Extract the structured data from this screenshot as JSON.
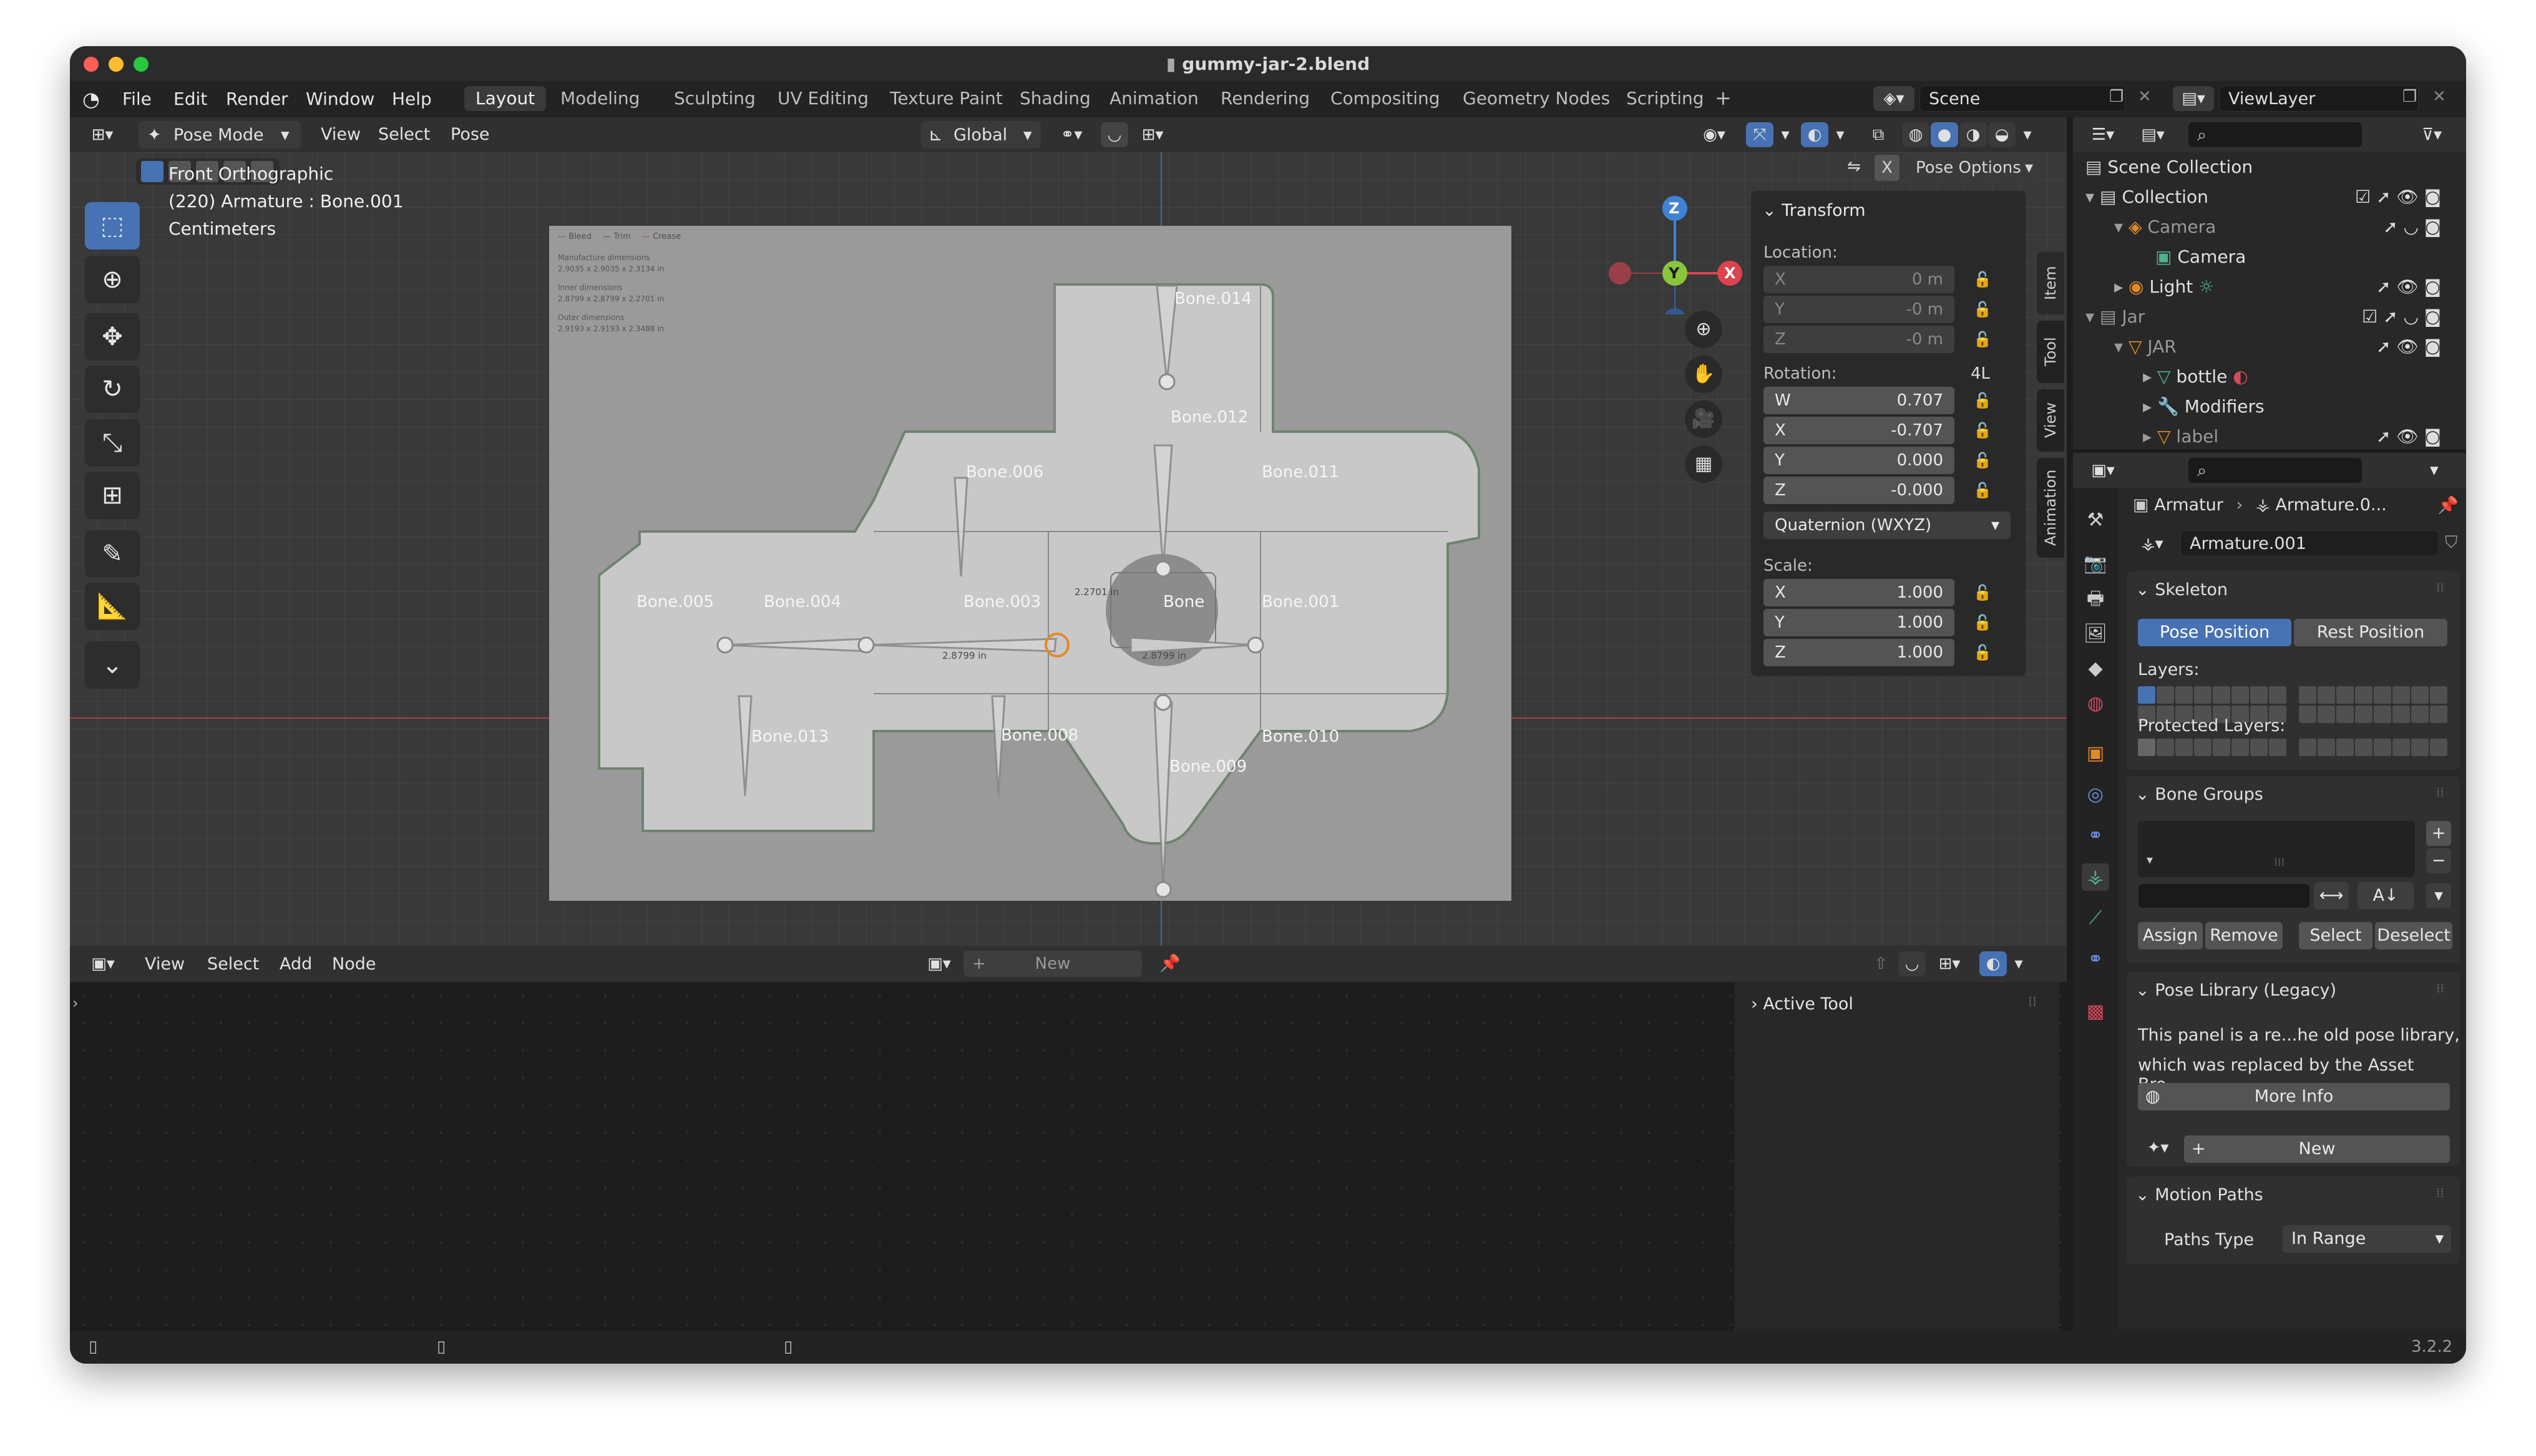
{
  "window": {
    "title": "gummy-jar-2.blend",
    "version": "3.2.2"
  },
  "menu": [
    "File",
    "Edit",
    "Render",
    "Window",
    "Help"
  ],
  "workspaces": [
    "Layout",
    "Modeling",
    "Sculpting",
    "UV Editing",
    "Texture Paint",
    "Shading",
    "Animation",
    "Rendering",
    "Compositing",
    "Geometry Nodes",
    "Scripting"
  ],
  "active_workspace": "Layout",
  "scene": {
    "name": "Scene",
    "view_layer": "ViewLayer"
  },
  "viewport": {
    "mode": "Pose Mode",
    "header_menus": [
      "View",
      "Select",
      "Pose"
    ],
    "orientation": "Global",
    "overlay_lines": [
      "Front Orthographic",
      "(220) Armature : Bone.001",
      "Centimeters"
    ],
    "pose_options": "Pose Options",
    "gizmo_axes": {
      "z": "Z",
      "y": "Y",
      "x": "X"
    },
    "dieline_legend": [
      "Bleed",
      "Trim",
      "Crease"
    ],
    "dieline_notes": [
      "Manufacture dimensions",
      "2.9035 x 2.9035 x 2.3134 in",
      "Inner dimensions",
      "2.8799 x 2.8799 x 2.2701 in",
      "Outer dimensions",
      "2.9193 x 2.9193 x 2.3488 in"
    ],
    "dim_labels": [
      "2.8799 in",
      "2.8799 in",
      "2.2701 in"
    ],
    "bones": [
      "Bone.014",
      "Bone.012",
      "Bone.006",
      "Bone.011",
      "Bone.005",
      "Bone.004",
      "Bone.003",
      "Bone",
      "Bone.001",
      "Bone.013",
      "Bone.008",
      "Bone.009",
      "Bone.010"
    ]
  },
  "sidebar_tabs": [
    "Item",
    "Tool",
    "View",
    "Animation"
  ],
  "transform": {
    "title": "Transform",
    "location_label": "Location:",
    "location": [
      {
        "axis": "X",
        "value": "0 m"
      },
      {
        "axis": "Y",
        "value": "-0 m"
      },
      {
        "axis": "Z",
        "value": "-0 m"
      }
    ],
    "rotation_label": "Rotation:",
    "rotation_mode_short": "4L",
    "rotation": [
      {
        "axis": "W",
        "value": "0.707"
      },
      {
        "axis": "X",
        "value": "-0.707"
      },
      {
        "axis": "Y",
        "value": "0.000"
      },
      {
        "axis": "Z",
        "value": "-0.000"
      }
    ],
    "rotation_mode": "Quaternion (WXYZ)",
    "scale_label": "Scale:",
    "scale": [
      {
        "axis": "X",
        "value": "1.000"
      },
      {
        "axis": "Y",
        "value": "1.000"
      },
      {
        "axis": "Z",
        "value": "1.000"
      }
    ]
  },
  "node_editor": {
    "menus": [
      "View",
      "Select",
      "Add",
      "Node"
    ],
    "new_label": "New",
    "active_tool": "Active Tool"
  },
  "outliner": {
    "items": [
      {
        "label": "Scene Collection",
        "indent": 0
      },
      {
        "label": "Collection",
        "indent": 1
      },
      {
        "label": "Camera",
        "indent": 2
      },
      {
        "label": "Camera",
        "indent": 3
      },
      {
        "label": "Light",
        "indent": 2
      },
      {
        "label": "Jar",
        "indent": 1
      },
      {
        "label": "JAR",
        "indent": 2
      },
      {
        "label": "bottle",
        "indent": 3
      },
      {
        "label": "Modifiers",
        "indent": 3
      },
      {
        "label": "label",
        "indent": 3
      }
    ]
  },
  "properties": {
    "breadcrumb": [
      "Armatur",
      "Armature.0..."
    ],
    "data_name": "Armature.001",
    "skeleton": {
      "title": "Skeleton",
      "pose_position": "Pose Position",
      "rest_position": "Rest Position",
      "layers": "Layers:",
      "protected_layers": "Protected Layers:"
    },
    "bone_groups": {
      "title": "Bone Groups",
      "assign": "Assign",
      "remove": "Remove",
      "select": "Select",
      "deselect": "Deselect"
    },
    "pose_library": {
      "title": "Pose Library (Legacy)",
      "line1": "This panel is a re...he old pose library,",
      "line2": "which was replaced by the Asset Bro...",
      "more_info": "More Info",
      "new": "New"
    },
    "motion_paths": {
      "title": "Motion Paths",
      "paths_type_label": "Paths Type",
      "paths_type_value": "In Range"
    }
  },
  "colors": {
    "accent": "#4772b3",
    "x_axis": "#dc4450",
    "y_axis": "#8ac53c",
    "z_axis": "#3f83d4"
  }
}
